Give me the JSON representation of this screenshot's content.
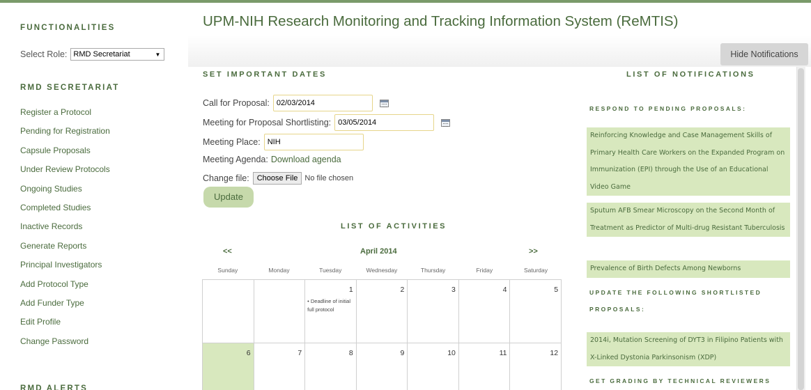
{
  "app": {
    "title": "UPM-NIH Research Monitoring and Tracking Information System (ReMTIS)"
  },
  "sidebar": {
    "functionalities_heading": "FUNCTIONALITIES",
    "select_role_label": "Select Role:",
    "selected_role": "RMD Secretariat",
    "section_heading": "RMD SECRETARIAT",
    "alerts_heading": "RMD ALERTS",
    "items": [
      "Register a Protocol",
      "Pending for Registration",
      "Capsule Proposals",
      "Under Review Protocols",
      "Ongoing Studies",
      "Completed Studies",
      "Inactive Records",
      "Generate Reports",
      "Principal Investigators",
      "Add Protocol Type",
      "Add Funder Type",
      "Edit Profile",
      "Change Password"
    ]
  },
  "toolbar": {
    "hide_notifications_label": "Hide Notifications"
  },
  "dates": {
    "heading": "SET IMPORTANT DATES",
    "call_label": "Call for Proposal:",
    "call_value": "02/03/2014",
    "meeting_label": "Meeting for Proposal Shortlisting:",
    "meeting_value": "03/05/2014",
    "place_label": "Meeting Place:",
    "place_value": "NIH",
    "agenda_label": "Meeting Agenda:",
    "agenda_link": "Download agenda",
    "file_label": "Change file:",
    "choose_file": "Choose File",
    "no_file": "No file chosen",
    "update_label": "Update"
  },
  "activities": {
    "heading": "LIST OF ACTIVITIES",
    "prev": "<<",
    "next": ">>",
    "month": "April 2014",
    "weekdays": [
      "Sunday",
      "Monday",
      "Tuesday",
      "Wednesday",
      "Thursday",
      "Friday",
      "Saturday"
    ],
    "weeks": [
      [
        {
          "day": "",
          "event": ""
        },
        {
          "day": "",
          "event": ""
        },
        {
          "day": "1",
          "event": "• Deadline of initial full protocol"
        },
        {
          "day": "2",
          "event": ""
        },
        {
          "day": "3",
          "event": ""
        },
        {
          "day": "4",
          "event": ""
        },
        {
          "day": "5",
          "event": ""
        }
      ],
      [
        {
          "day": "6",
          "event": "",
          "today": true
        },
        {
          "day": "7",
          "event": ""
        },
        {
          "day": "8",
          "event": ""
        },
        {
          "day": "9",
          "event": ""
        },
        {
          "day": "10",
          "event": ""
        },
        {
          "day": "11",
          "event": ""
        },
        {
          "day": "12",
          "event": ""
        }
      ]
    ]
  },
  "notifications": {
    "heading": "LIST OF NOTIFICATIONS",
    "respond_heading": "RESPOND TO PENDING PROPOSALS:",
    "pending": [
      "Reinforcing Knowledge and Case Management Skills of Primary Health Care Workers on the Expanded Program on Immunization (EPI) through the Use of an Educational Video Game",
      "Sputum AFB Smear Microscopy on the Second Month of Treatment as Predictor of Multi-drug Resistant Tuberculosis",
      "Prevalence of Birth Defects Among Newborns"
    ],
    "update_heading": "UPDATE THE FOLLOWING SHORTLISTED PROPOSALS:",
    "shortlisted": [
      "2014i, Mutation Screening of DYT3 in Filipino Patients with X-Linked Dystonia Parkinsonism (XDP)"
    ],
    "grading_heading": "GET GRADING BY TECHNICAL REVIEWERS FOR"
  },
  "colors": {
    "accent": "#4a6b3d",
    "highlight": "#d8e8be",
    "button": "#c6d9ab"
  }
}
